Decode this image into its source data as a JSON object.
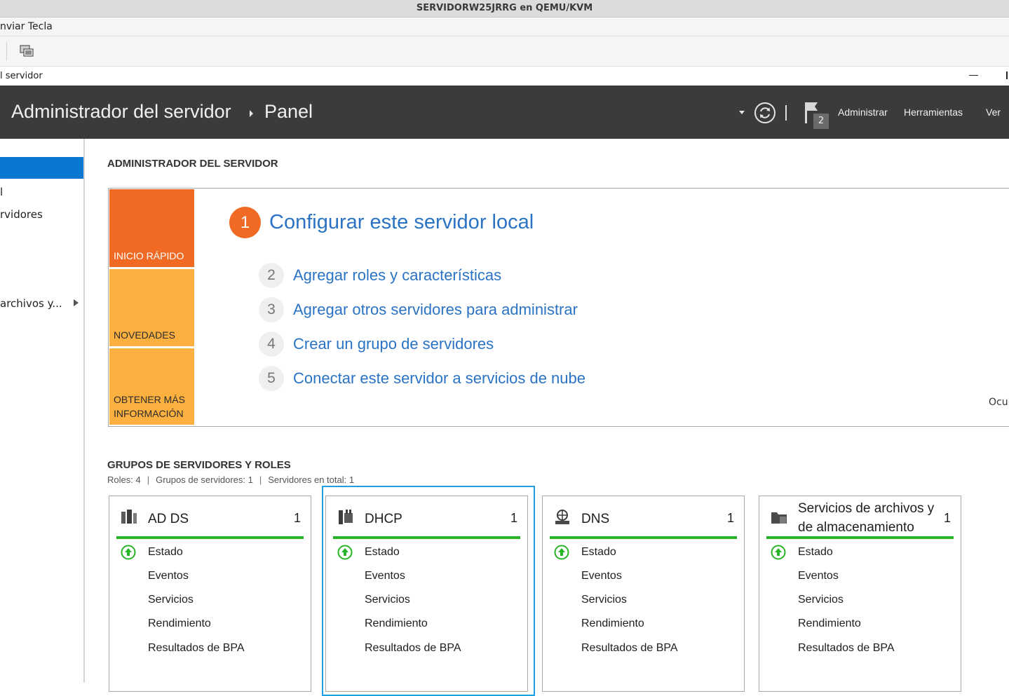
{
  "vm": {
    "title": "SERVIDORW25JRRG en QEMU/KVM",
    "menu_send_key": "nviar Tecla"
  },
  "window": {
    "title": "l servidor"
  },
  "header": {
    "app_name": "Administrador del servidor",
    "page_name": "Panel",
    "notification_count": "2",
    "menu": {
      "manage": "Administrar",
      "tools": "Herramientas",
      "view": "Ver"
    }
  },
  "nav": {
    "items": [
      {
        "label": ""
      },
      {
        "label": "l"
      },
      {
        "label": "rvidores"
      },
      {
        "label": "archivos y..."
      }
    ]
  },
  "welcome": {
    "section_title": "ADMINISTRADOR DEL SERVIDOR",
    "tiles": {
      "quick_start": "INICIO RÁPIDO",
      "whats_new": "NOVEDADES",
      "learn_more": "OBTENER MÁS INFORMACIÓN"
    },
    "main_step": {
      "number": "1",
      "label": "Configurar este servidor local"
    },
    "steps": [
      {
        "number": "2",
        "label": "Agregar roles y características"
      },
      {
        "number": "3",
        "label": "Agregar otros servidores para administrar"
      },
      {
        "number": "4",
        "label": "Crear un grupo de servidores"
      },
      {
        "number": "5",
        "label": "Conectar este servidor a servicios de nube"
      }
    ],
    "hide_link": "Ocul"
  },
  "groups": {
    "section_title": "GRUPOS DE SERVIDORES Y ROLES",
    "stats": {
      "roles": "Roles: 4",
      "server_groups": "Grupos de servidores: 1",
      "servers_total": "Servidores en total: 1"
    },
    "row_labels": {
      "status": "Estado",
      "events": "Eventos",
      "services": "Servicios",
      "performance": "Rendimiento",
      "bpa": "Resultados de BPA"
    },
    "cards": [
      {
        "title": "AD DS",
        "count": "1",
        "icon": "ad-ds-icon"
      },
      {
        "title": "DHCP",
        "count": "1",
        "icon": "dhcp-icon"
      },
      {
        "title": "DNS",
        "count": "1",
        "icon": "dns-icon"
      },
      {
        "title": "Servicios de archivos y de almacenamiento",
        "count": "1",
        "icon": "file-storage-icon"
      }
    ],
    "status_color": "#27b427",
    "focus_color": "#1ba1e2"
  },
  "colors": {
    "header_bg": "#3b3b3b",
    "accent_orange": "#f06a23",
    "tile_yellow": "#fcb040",
    "link_blue": "#2a73c4",
    "nav_selected": "#0a78d1"
  }
}
